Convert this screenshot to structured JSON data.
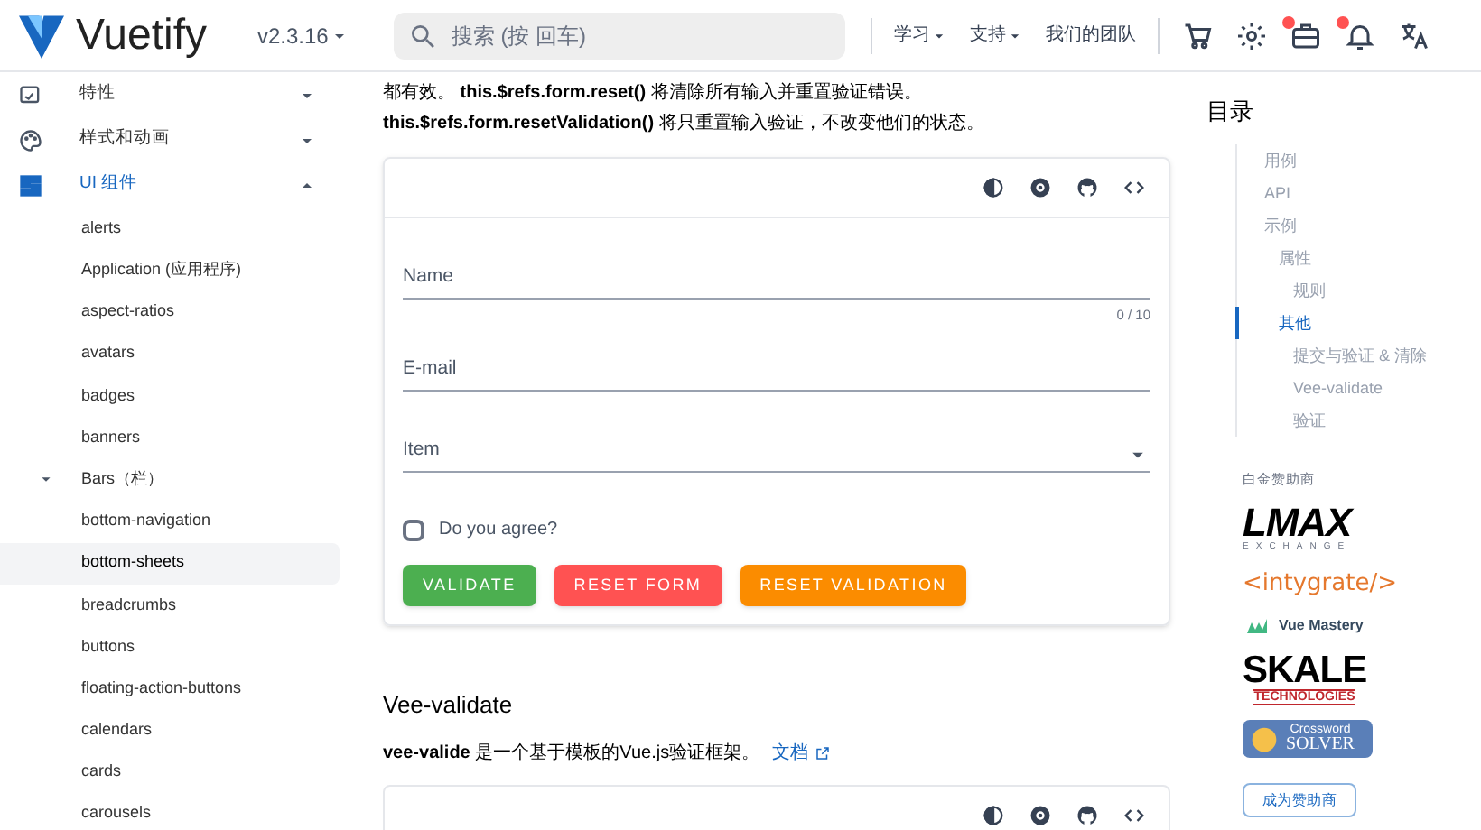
{
  "header": {
    "logo_text": "Vuetify",
    "version": "v2.3.16",
    "search": {
      "placeholder": "搜索 (按 回车)"
    },
    "nav": [
      {
        "label": "学习",
        "dropdown": true
      },
      {
        "label": "支持",
        "dropdown": true
      },
      {
        "label": "我们的团队",
        "dropdown": false
      }
    ],
    "icons": [
      {
        "badge": false
      },
      {
        "badge": false
      },
      {
        "badge": true
      },
      {
        "badge": true
      },
      {
        "badge": false
      }
    ]
  },
  "sidebar": {
    "items": [
      {
        "label": "特性",
        "expanded": false,
        "selected": false
      },
      {
        "label": "样式和动画",
        "expanded": false,
        "selected": false
      },
      {
        "label": "UI 组件",
        "expanded": true,
        "selected": false,
        "children": [
          {
            "label": "alerts",
            "selected": false
          },
          {
            "label": "Application (应用程序)",
            "selected": false
          },
          {
            "label": "aspect-ratios",
            "selected": false
          },
          {
            "label": "avatars",
            "selected": false
          },
          {
            "label": "badges",
            "selected": false
          },
          {
            "label": "banners",
            "selected": false
          },
          {
            "label": "Bars（栏）",
            "selected": false,
            "expanded": true,
            "children": [
              {
                "label": "bottom-navigation",
                "selected": false
              },
              {
                "label": "bottom-sheets",
                "selected": true
              }
            ]
          },
          {
            "label": "breadcrumbs",
            "selected": false
          },
          {
            "label": "buttons",
            "selected": false
          },
          {
            "label": "floating-action-buttons",
            "selected": false
          },
          {
            "label": "calendars",
            "selected": false
          },
          {
            "label": "cards",
            "selected": false
          },
          {
            "label": "carousels",
            "selected": false
          }
        ]
      }
    ]
  },
  "main": {
    "intro": [
      "都有效。 **this.$refs.form.reset()** 将清除所有输入并重置验证错误。",
      "**this.$refs.form.resetValidation()** 将只重置输入验证，不改变他们的状态。"
    ],
    "form": {
      "fields": [
        {
          "kind": "text",
          "label": "Name",
          "counter": "0 / 10"
        },
        {
          "kind": "text",
          "label": "E-mail"
        },
        {
          "kind": "select",
          "label": "Item"
        }
      ],
      "checkbox": {
        "label": "Do you agree?",
        "checked": false
      },
      "buttons": [
        {
          "label": "VALIDATE",
          "color": "#4caf50"
        },
        {
          "label": "RESET FORM",
          "color": "#ff5252"
        },
        {
          "label": "RESET VALIDATION",
          "color": "#fb8c00"
        }
      ]
    },
    "section": {
      "heading": "Vee-validate",
      "text": "**vee-valide** 是一个基于模板的Vue.js验证框架。",
      "link": "文档"
    }
  },
  "toc": {
    "title": "目录",
    "items": [
      {
        "label": "用例",
        "selected": false
      },
      {
        "label": "API",
        "selected": false
      },
      {
        "label": "示例",
        "selected": false,
        "children": [
          {
            "label": "属性",
            "selected": false,
            "children": [
              {
                "label": "规则",
                "selected": false
              }
            ]
          },
          {
            "label": "其他",
            "selected": true,
            "children": [
              {
                "label": "提交与验证 & 清除",
                "selected": false
              },
              {
                "label": "Vee-validate",
                "selected": false
              },
              {
                "label": "验证",
                "selected": false
              }
            ]
          }
        ]
      }
    ]
  },
  "sponsors": {
    "title": "白金赞助商",
    "logos": [
      {
        "kind": "lmax",
        "text": "LMAX",
        "sub": "EXCHANGE"
      },
      {
        "kind": "intygrate",
        "text": "<intygrate/>"
      },
      {
        "kind": "vuemastery",
        "text": "Vue Mastery"
      },
      {
        "kind": "skale",
        "text": "SKALE",
        "sub": "TECHNOLOGIES"
      },
      {
        "kind": "crossword",
        "text": "Crossword",
        "sub": "SOLVER"
      }
    ],
    "button": "成为赞助商"
  }
}
